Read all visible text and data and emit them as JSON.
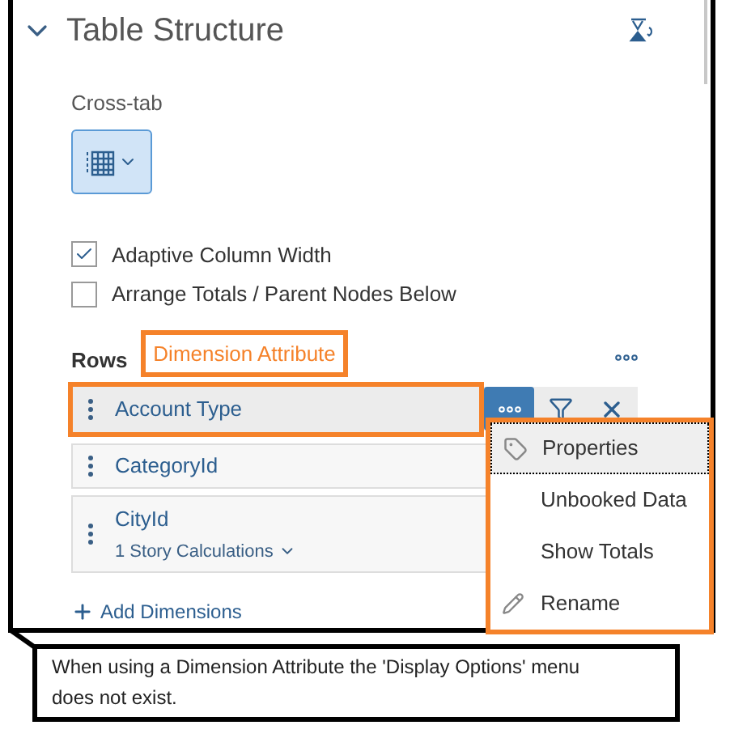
{
  "panel": {
    "title": "Table Structure",
    "expanded": true
  },
  "cross_tab": {
    "label": "Cross-tab",
    "selected": true
  },
  "options": [
    {
      "label": "Adaptive Column Width",
      "checked": true
    },
    {
      "label": "Arrange Totals / Parent Nodes Below",
      "checked": false
    }
  ],
  "rows": {
    "label": "Rows",
    "annotation": "Dimension Attribute",
    "items": [
      {
        "name": "Account Type",
        "selected": true
      },
      {
        "name": "CategoryId",
        "selected": false
      },
      {
        "name": "CityId",
        "selected": false,
        "sub": "1 Story Calculations"
      }
    ],
    "add": "Add Dimensions"
  },
  "menu": [
    {
      "label": "Properties",
      "kind": "tag",
      "selected": true
    },
    {
      "label": "Unbooked Data",
      "kind": "plain",
      "selected": false
    },
    {
      "label": "Show Totals",
      "kind": "plain",
      "selected": false
    },
    {
      "label": "Rename",
      "kind": "pencil",
      "selected": false
    }
  ],
  "callout": "When using a Dimension Attribute the 'Display Options' menu does not exist."
}
